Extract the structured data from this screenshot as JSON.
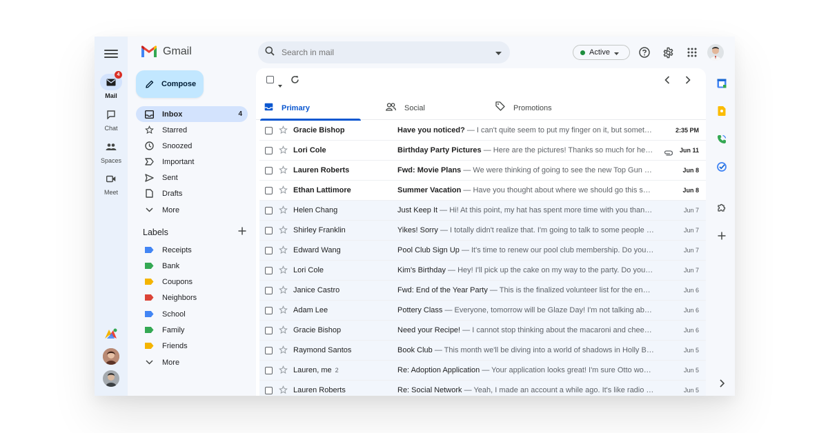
{
  "app": {
    "name": "Gmail",
    "colors": {
      "accent": "#0b57d0",
      "compose_bg": "#c2e7ff",
      "active_bg": "#d3e3fd",
      "badge": "#d93025",
      "online": "#1e8e3e"
    }
  },
  "rail": {
    "items": [
      {
        "label": "Mail",
        "icon": "mail-icon",
        "badge": "4",
        "active": true
      },
      {
        "label": "Chat",
        "icon": "chat-icon"
      },
      {
        "label": "Spaces",
        "icon": "spaces-icon"
      },
      {
        "label": "Meet",
        "icon": "meet-icon"
      }
    ]
  },
  "nav": {
    "compose_label": "Compose",
    "items": [
      {
        "label": "Inbox",
        "icon": "inbox-icon",
        "count": "4",
        "active": true
      },
      {
        "label": "Starred",
        "icon": "star-icon"
      },
      {
        "label": "Snoozed",
        "icon": "clock-icon"
      },
      {
        "label": "Important",
        "icon": "important-icon"
      },
      {
        "label": "Sent",
        "icon": "send-icon"
      },
      {
        "label": "Drafts",
        "icon": "draft-icon"
      },
      {
        "label": "More",
        "icon": "chevron-down-icon"
      }
    ],
    "labels_title": "Labels",
    "labels": [
      {
        "label": "Receipts",
        "color": "#4285f4"
      },
      {
        "label": "Bank",
        "color": "#34a853"
      },
      {
        "label": "Coupons",
        "color": "#f4b400"
      },
      {
        "label": "Neighbors",
        "color": "#db4437"
      },
      {
        "label": "School",
        "color": "#4285f4"
      },
      {
        "label": "Family",
        "color": "#34a853"
      },
      {
        "label": "Friends",
        "color": "#f4b400"
      }
    ],
    "labels_more": "More"
  },
  "search": {
    "placeholder": "Search in mail"
  },
  "status": {
    "label": "Active"
  },
  "tabs": [
    {
      "label": "Primary",
      "icon": "inbox-tab-icon",
      "active": true
    },
    {
      "label": "Social",
      "icon": "people-icon"
    },
    {
      "label": "Promotions",
      "icon": "tag-icon"
    }
  ],
  "emails": [
    {
      "sender": "Gracie Bishop",
      "count": "",
      "subject": "Have you noticed?",
      "snippet": " — I can't quite seem to put my finger on it, but somethin...",
      "date": "2:35 PM",
      "unread": true,
      "attachment": false
    },
    {
      "sender": "Lori Cole",
      "count": "",
      "subject": "Birthday Party Pictures",
      "snippet": " — Here are the pictures! Thanks so much for helpi...",
      "date": "Jun 11",
      "unread": true,
      "attachment": true
    },
    {
      "sender": "Lauren Roberts",
      "count": "",
      "subject": "Fwd: Movie Plans",
      "snippet": " — We were thinking of going to see the new Top Gun mo...",
      "date": "Jun 8",
      "unread": true,
      "attachment": false
    },
    {
      "sender": "Ethan Lattimore",
      "count": "",
      "subject": "Summer Vacation",
      "snippet": " — Have you thought about where we should go this sum...",
      "date": "Jun 8",
      "unread": true,
      "attachment": false
    },
    {
      "sender": "Helen Chang",
      "count": "",
      "subject": "Just Keep It",
      "snippet": " — Hi! At this point, my hat has spent more time with you than w...",
      "date": "Jun 7",
      "unread": false,
      "attachment": false
    },
    {
      "sender": "Shirley Franklin",
      "count": "",
      "subject": "Yikes! Sorry",
      "snippet": " — I totally didn't realize that. I'm going to talk to some people a...",
      "date": "Jun 7",
      "unread": false,
      "attachment": false
    },
    {
      "sender": "Edward Wang",
      "count": "",
      "subject": "Pool Club Sign Up",
      "snippet": " — It's time to renew our pool club membership. Do you re...",
      "date": "Jun 7",
      "unread": false,
      "attachment": false
    },
    {
      "sender": "Lori Cole",
      "count": "",
      "subject": "Kim's Birthday",
      "snippet": " — Hey! I'll pick up the cake on my way to the party. Do you th...",
      "date": "Jun 7",
      "unread": false,
      "attachment": false
    },
    {
      "sender": "Janice Castro",
      "count": "",
      "subject": "Fwd: End of the Year Party",
      "snippet": " — This is the finalized volunteer list for the end of...",
      "date": "Jun 6",
      "unread": false,
      "attachment": false
    },
    {
      "sender": "Adam Lee",
      "count": "",
      "subject": "Pottery Class",
      "snippet": " — Everyone, tomorrow will be Glaze Day! I'm not talking about...",
      "date": "Jun 6",
      "unread": false,
      "attachment": false
    },
    {
      "sender": "Gracie Bishop",
      "count": "",
      "subject": "Need your Recipe!",
      "snippet": " — I cannot stop thinking about the macaroni and cheese...",
      "date": "Jun 6",
      "unread": false,
      "attachment": false
    },
    {
      "sender": "Raymond Santos",
      "count": "",
      "subject": "Book Club",
      "snippet": " — This month we'll be diving into a world of shadows in Holly Bla...",
      "date": "Jun 5",
      "unread": false,
      "attachment": false
    },
    {
      "sender": "Lauren, me",
      "count": "2",
      "subject": "Re: Adoption Application",
      "snippet": " — Your application looks great! I'm sure Otto would...",
      "date": "Jun 5",
      "unread": false,
      "attachment": false
    },
    {
      "sender": "Lauren Roberts",
      "count": "",
      "subject": "Re: Social Network",
      "snippet": " — Yeah, I made an account a while ago. It's like radio but...",
      "date": "Jun 5",
      "unread": false,
      "attachment": false
    }
  ]
}
